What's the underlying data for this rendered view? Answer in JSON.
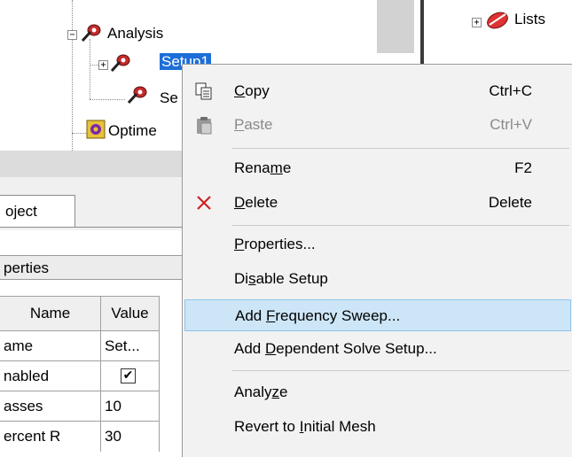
{
  "tree": {
    "analysis_label": "Analysis",
    "setup1_label": "Setup1",
    "setup2_label": "Se",
    "optimetrics_label": "Optime",
    "lists_label": "Lists"
  },
  "panel": {
    "project_tab_label": "oject",
    "properties_header": "perties",
    "columns": [
      "Name",
      "Value"
    ],
    "rows": [
      {
        "name": "ame",
        "value": "Set..."
      },
      {
        "name": "nabled",
        "value": "checked"
      },
      {
        "name": "asses",
        "value": "10"
      },
      {
        "name": "ercent R",
        "value": "30"
      }
    ]
  },
  "context_menu": {
    "items": [
      {
        "id": "copy",
        "pre": "",
        "ul": "C",
        "post": "opy",
        "shortcut": "Ctrl+C",
        "icon": "copy-icon",
        "enabled": true
      },
      {
        "id": "paste",
        "pre": "",
        "ul": "P",
        "post": "aste",
        "shortcut": "Ctrl+V",
        "icon": "paste-icon",
        "enabled": false
      },
      {
        "id": "rename",
        "pre": "Rena",
        "ul": "m",
        "post": "e",
        "shortcut": "F2",
        "icon": "",
        "enabled": true
      },
      {
        "id": "delete",
        "pre": "",
        "ul": "D",
        "post": "elete",
        "shortcut": "Delete",
        "icon": "delete-icon",
        "enabled": true
      },
      {
        "id": "properties",
        "pre": "",
        "ul": "P",
        "post": "roperties...",
        "shortcut": "",
        "icon": "",
        "enabled": true
      },
      {
        "id": "disable_setup",
        "pre": "Di",
        "ul": "s",
        "post": "able Setup",
        "shortcut": "",
        "icon": "",
        "enabled": true
      },
      {
        "id": "add_frequency_sweep",
        "pre": "Add ",
        "ul": "F",
        "post": "requency Sweep...",
        "shortcut": "",
        "icon": "",
        "enabled": true,
        "highlighted": true
      },
      {
        "id": "add_dependent_solve_setup",
        "pre": "Add ",
        "ul": "D",
        "post": "ependent Solve Setup...",
        "shortcut": "",
        "icon": "",
        "enabled": true
      },
      {
        "id": "analyze",
        "pre": "Analy",
        "ul": "z",
        "post": "e",
        "shortcut": "",
        "icon": "",
        "enabled": true
      },
      {
        "id": "revert_to_initial_mesh",
        "pre": "Revert to ",
        "ul": "I",
        "post": "nitial Mesh",
        "shortcut": "",
        "icon": "",
        "enabled": true
      }
    ]
  },
  "colors": {
    "menu_highlight": "#cde6f7",
    "menu_highlight_border": "#8fc3ea",
    "selection_blue": "#1e6ed8",
    "delete_red": "#cc2222"
  }
}
